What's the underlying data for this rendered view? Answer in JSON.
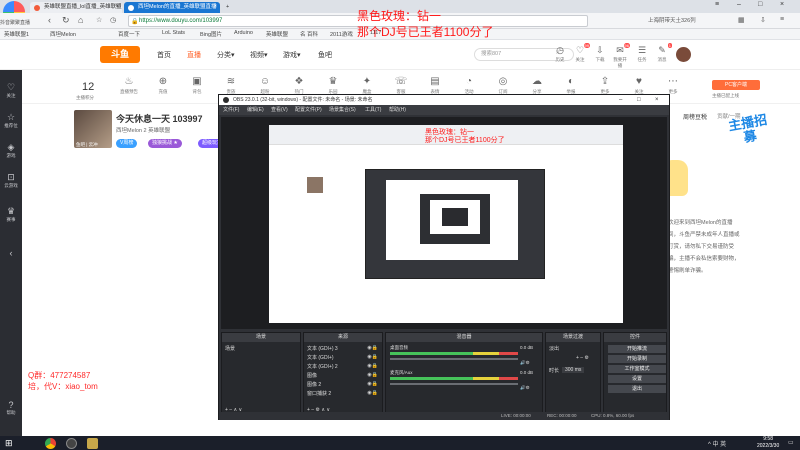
{
  "browser": {
    "logo_label": "抖音聚聚直播",
    "tabs": [
      {
        "label": "英雄联盟直播_lol直播_英雄联盟",
        "active": false
      },
      {
        "label": "西坦Melon的直播_英雄联盟直播",
        "active": true
      }
    ],
    "url": "https://www.douyu.com/103997",
    "weather": "上海阴带天土326列",
    "bookmarks": [
      "英雄联盟1",
      "西坦Melon",
      "百度一下",
      "LoL Stats",
      "Bing图片",
      "Arduino",
      "英雄联盟",
      "名 百科",
      "2011游戏",
      "1117"
    ]
  },
  "site": {
    "logo": "斗鱼",
    "nav": [
      {
        "label": "首页",
        "active": false
      },
      {
        "label": "直播",
        "active": true
      },
      {
        "label": "分类▾",
        "active": false
      },
      {
        "label": "视频▾",
        "active": false
      },
      {
        "label": "游戏▾",
        "active": false
      },
      {
        "label": "鱼吧",
        "active": false
      }
    ],
    "search_placeholder": "搜索807",
    "top_icons": [
      {
        "icon": "history-icon",
        "glyph": "◷",
        "label": "历史",
        "badge": ""
      },
      {
        "icon": "follow-icon",
        "glyph": "♡",
        "label": "关注",
        "badge": "99"
      },
      {
        "icon": "download-icon",
        "glyph": "⇩",
        "label": "下载",
        "badge": ""
      },
      {
        "icon": "broadcast-icon",
        "glyph": "✉",
        "label": "我要开播",
        "badge": "96"
      },
      {
        "icon": "task-icon",
        "glyph": "☰",
        "label": "任务",
        "badge": ""
      },
      {
        "icon": "message-icon",
        "glyph": "✎",
        "label": "消息",
        "badge": "1"
      }
    ],
    "categories": [
      {
        "icon": "fire-icon",
        "glyph": "♨",
        "label": "直播预告"
      },
      {
        "icon": "gift-icon",
        "glyph": "⊕",
        "label": "充值"
      },
      {
        "icon": "gift-box-icon",
        "glyph": "▣",
        "label": "背包"
      },
      {
        "icon": "wave-icon",
        "glyph": "≋",
        "label": "贵族"
      },
      {
        "icon": "face-icon",
        "glyph": "☺",
        "label": "超粉"
      },
      {
        "icon": "gift2-icon",
        "glyph": "❖",
        "label": "热门"
      },
      {
        "icon": "cup-icon",
        "glyph": "♛",
        "label": "乐园"
      },
      {
        "icon": "fire2-icon",
        "glyph": "✦",
        "label": "魔盒"
      },
      {
        "icon": "phone-icon",
        "glyph": "☏",
        "label": "客服"
      },
      {
        "icon": "chart-icon",
        "glyph": "▤",
        "label": "表情"
      },
      {
        "icon": "clock-icon",
        "glyph": "◔",
        "label": "活动"
      },
      {
        "icon": "bell-icon",
        "glyph": "◎",
        "label": "订阅"
      },
      {
        "icon": "cloud-icon",
        "glyph": "☁",
        "label": "分享"
      },
      {
        "icon": "speed-icon",
        "glyph": "◐",
        "label": "举报"
      },
      {
        "icon": "share-icon",
        "glyph": "⇪",
        "label": "更多"
      },
      {
        "icon": "heart-icon",
        "glyph": "♥",
        "label": "关注"
      },
      {
        "icon": "more-icon",
        "glyph": "⋯",
        "label": "更多"
      }
    ],
    "live_count": "12",
    "live_count_label": "主播积分",
    "pc_client": "PC客户端",
    "pc_client_sub": "主播已配上线"
  },
  "sidebar": [
    {
      "icon": "follow-icon",
      "glyph": "♡",
      "label": "关注"
    },
    {
      "icon": "recommend-icon",
      "glyph": "☆",
      "label": "推荐位"
    },
    {
      "icon": "game-icon",
      "glyph": "◈",
      "label": "游戏"
    },
    {
      "icon": "cloud-game-icon",
      "glyph": "⊡",
      "label": "云游戏"
    },
    {
      "icon": "trophy-icon",
      "glyph": "♛",
      "label": "赛事"
    },
    {
      "icon": "help-icon",
      "glyph": "?",
      "label": "帮助"
    }
  ],
  "streamer": {
    "title": "今天休息一天 103997",
    "room_line": "西坦Melon 2 英雄联盟",
    "avatar_label": "鱼吧 | 云冲",
    "pills": [
      {
        "label": "V周榜",
        "color": "#3aa0ff"
      },
      {
        "label": "独狼挑战 ★",
        "color": "#9a59d8"
      },
      {
        "label": "超级玩家",
        "color": "#7d5cff"
      }
    ]
  },
  "right_panel": {
    "title": "周榜豆税",
    "title2": "贡献/一期",
    "promo": "主播招募",
    "notice": "欢迎来到西坦Melon的直播间，斗鱼严禁未成年人直播或打赏，请勿私下交易谨防受骗，主播不会私信索要财物，警惕刷单诈骗。"
  },
  "overlay": {
    "line1": "黑色玫瑰：钻一",
    "line2": "那个DJ号已王者1100分了"
  },
  "watermark": {
    "qq": "Q群：477274587",
    "daigun": "培，代V：xiao_tom"
  },
  "obs": {
    "title": "OBS 23.0.1 (32-bit, windows) - 配置文件: 未命名 - 场景: 未命名",
    "menu": [
      "文件(F)",
      "编辑(E)",
      "查看(V)",
      "配置文件(P)",
      "场景集合(S)",
      "工具(T)",
      "帮助(H)"
    ],
    "panels": {
      "scenes": "场景",
      "sources": "来源",
      "mixer": "混音器",
      "transitions": "场景过渡",
      "controls": "控件"
    },
    "scene_item": "场景",
    "sources": [
      "文本 (GDI+) 3",
      "文本 (GDI+)",
      "文本 (GDI+) 2",
      "图像",
      "图像 2",
      "窗口捕获 2"
    ],
    "mixer": [
      {
        "label": "桌面音频",
        "db": "0.0 dB"
      },
      {
        "label": "麦克风/Aux",
        "db": "0.0 dB"
      }
    ],
    "transition": "淡出",
    "duration_label": "时长",
    "duration": "300 ms",
    "controls": [
      "开始推流",
      "开始录制",
      "工作室模式",
      "设置",
      "退出"
    ],
    "status": {
      "live": "LIVE: 00:00:00",
      "rec": "REC: 00:00:00",
      "cpu": "CPU: 0.8%, 60.00 fps"
    },
    "nested_red1": "黑色玫瑰：钻一",
    "nested_red2": "那个DJ号已王者1100分了"
  },
  "taskbar": {
    "time": "9:58",
    "date": "2022/3/30",
    "tray": "^ 中 英"
  },
  "colors": {
    "accent": "#ff5d23",
    "tab_active": "#1976d2",
    "red_text": "#ff1a1a",
    "obs_bg": "#2f3136"
  }
}
